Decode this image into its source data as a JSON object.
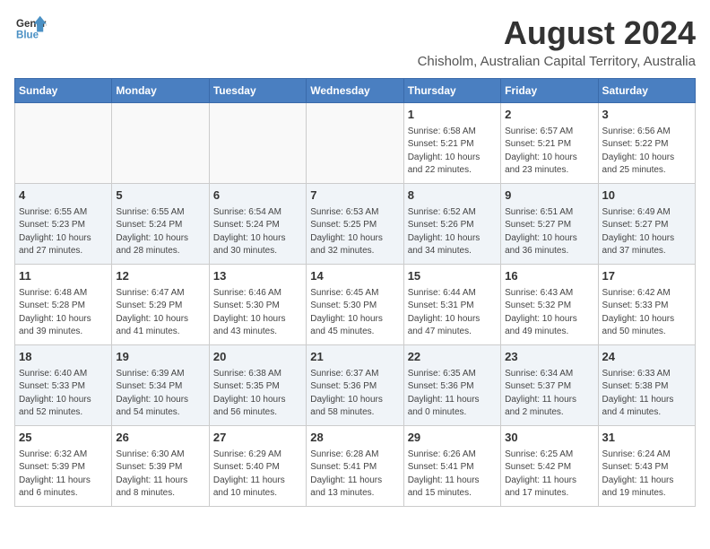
{
  "logo": {
    "line1": "General",
    "line2": "Blue"
  },
  "title": "August 2024",
  "location": "Chisholm, Australian Capital Territory, Australia",
  "days_header": [
    "Sunday",
    "Monday",
    "Tuesday",
    "Wednesday",
    "Thursday",
    "Friday",
    "Saturday"
  ],
  "weeks": [
    [
      {
        "day": "",
        "info": ""
      },
      {
        "day": "",
        "info": ""
      },
      {
        "day": "",
        "info": ""
      },
      {
        "day": "",
        "info": ""
      },
      {
        "day": "1",
        "info": "Sunrise: 6:58 AM\nSunset: 5:21 PM\nDaylight: 10 hours\nand 22 minutes."
      },
      {
        "day": "2",
        "info": "Sunrise: 6:57 AM\nSunset: 5:21 PM\nDaylight: 10 hours\nand 23 minutes."
      },
      {
        "day": "3",
        "info": "Sunrise: 6:56 AM\nSunset: 5:22 PM\nDaylight: 10 hours\nand 25 minutes."
      }
    ],
    [
      {
        "day": "4",
        "info": "Sunrise: 6:55 AM\nSunset: 5:23 PM\nDaylight: 10 hours\nand 27 minutes."
      },
      {
        "day": "5",
        "info": "Sunrise: 6:55 AM\nSunset: 5:24 PM\nDaylight: 10 hours\nand 28 minutes."
      },
      {
        "day": "6",
        "info": "Sunrise: 6:54 AM\nSunset: 5:24 PM\nDaylight: 10 hours\nand 30 minutes."
      },
      {
        "day": "7",
        "info": "Sunrise: 6:53 AM\nSunset: 5:25 PM\nDaylight: 10 hours\nand 32 minutes."
      },
      {
        "day": "8",
        "info": "Sunrise: 6:52 AM\nSunset: 5:26 PM\nDaylight: 10 hours\nand 34 minutes."
      },
      {
        "day": "9",
        "info": "Sunrise: 6:51 AM\nSunset: 5:27 PM\nDaylight: 10 hours\nand 36 minutes."
      },
      {
        "day": "10",
        "info": "Sunrise: 6:49 AM\nSunset: 5:27 PM\nDaylight: 10 hours\nand 37 minutes."
      }
    ],
    [
      {
        "day": "11",
        "info": "Sunrise: 6:48 AM\nSunset: 5:28 PM\nDaylight: 10 hours\nand 39 minutes."
      },
      {
        "day": "12",
        "info": "Sunrise: 6:47 AM\nSunset: 5:29 PM\nDaylight: 10 hours\nand 41 minutes."
      },
      {
        "day": "13",
        "info": "Sunrise: 6:46 AM\nSunset: 5:30 PM\nDaylight: 10 hours\nand 43 minutes."
      },
      {
        "day": "14",
        "info": "Sunrise: 6:45 AM\nSunset: 5:30 PM\nDaylight: 10 hours\nand 45 minutes."
      },
      {
        "day": "15",
        "info": "Sunrise: 6:44 AM\nSunset: 5:31 PM\nDaylight: 10 hours\nand 47 minutes."
      },
      {
        "day": "16",
        "info": "Sunrise: 6:43 AM\nSunset: 5:32 PM\nDaylight: 10 hours\nand 49 minutes."
      },
      {
        "day": "17",
        "info": "Sunrise: 6:42 AM\nSunset: 5:33 PM\nDaylight: 10 hours\nand 50 minutes."
      }
    ],
    [
      {
        "day": "18",
        "info": "Sunrise: 6:40 AM\nSunset: 5:33 PM\nDaylight: 10 hours\nand 52 minutes."
      },
      {
        "day": "19",
        "info": "Sunrise: 6:39 AM\nSunset: 5:34 PM\nDaylight: 10 hours\nand 54 minutes."
      },
      {
        "day": "20",
        "info": "Sunrise: 6:38 AM\nSunset: 5:35 PM\nDaylight: 10 hours\nand 56 minutes."
      },
      {
        "day": "21",
        "info": "Sunrise: 6:37 AM\nSunset: 5:36 PM\nDaylight: 10 hours\nand 58 minutes."
      },
      {
        "day": "22",
        "info": "Sunrise: 6:35 AM\nSunset: 5:36 PM\nDaylight: 11 hours\nand 0 minutes."
      },
      {
        "day": "23",
        "info": "Sunrise: 6:34 AM\nSunset: 5:37 PM\nDaylight: 11 hours\nand 2 minutes."
      },
      {
        "day": "24",
        "info": "Sunrise: 6:33 AM\nSunset: 5:38 PM\nDaylight: 11 hours\nand 4 minutes."
      }
    ],
    [
      {
        "day": "25",
        "info": "Sunrise: 6:32 AM\nSunset: 5:39 PM\nDaylight: 11 hours\nand 6 minutes."
      },
      {
        "day": "26",
        "info": "Sunrise: 6:30 AM\nSunset: 5:39 PM\nDaylight: 11 hours\nand 8 minutes."
      },
      {
        "day": "27",
        "info": "Sunrise: 6:29 AM\nSunset: 5:40 PM\nDaylight: 11 hours\nand 10 minutes."
      },
      {
        "day": "28",
        "info": "Sunrise: 6:28 AM\nSunset: 5:41 PM\nDaylight: 11 hours\nand 13 minutes."
      },
      {
        "day": "29",
        "info": "Sunrise: 6:26 AM\nSunset: 5:41 PM\nDaylight: 11 hours\nand 15 minutes."
      },
      {
        "day": "30",
        "info": "Sunrise: 6:25 AM\nSunset: 5:42 PM\nDaylight: 11 hours\nand 17 minutes."
      },
      {
        "day": "31",
        "info": "Sunrise: 6:24 AM\nSunset: 5:43 PM\nDaylight: 11 hours\nand 19 minutes."
      }
    ]
  ]
}
